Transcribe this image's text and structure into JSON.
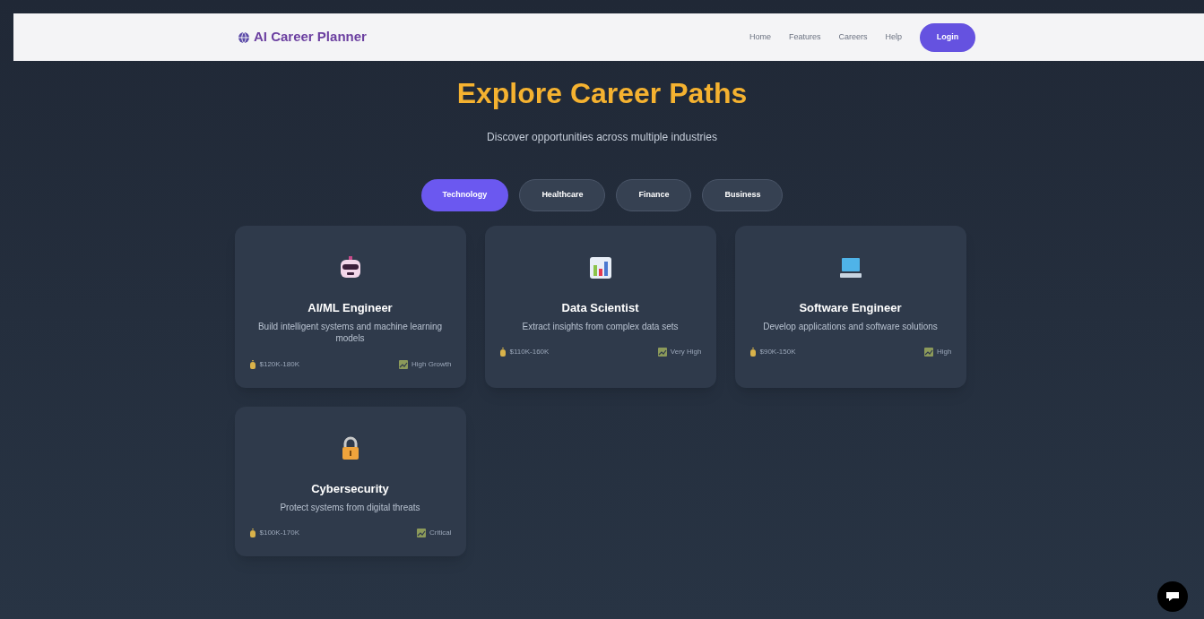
{
  "nav": {
    "brand": "AI Career Planner",
    "links": [
      "Home",
      "Features",
      "Careers",
      "Help"
    ],
    "login": "Login"
  },
  "hero": {
    "title": "Explore Career Paths",
    "subtitle": "Discover opportunities across multiple industries"
  },
  "tabs": [
    {
      "label": "Technology",
      "selected": true
    },
    {
      "label": "Healthcare",
      "selected": false
    },
    {
      "label": "Finance",
      "selected": false
    },
    {
      "label": "Business",
      "selected": false
    }
  ],
  "careers": [
    {
      "kind": "robot",
      "title": "AI/ML Engineer",
      "description": "Build intelligent systems and machine learning models",
      "salary": "$120K-180K",
      "growth": "High Growth"
    },
    {
      "kind": "chart",
      "title": "Data Scientist",
      "description": "Extract insights from complex data sets",
      "salary": "$110K-160K",
      "growth": "Very High"
    },
    {
      "kind": "laptop",
      "title": "Software Engineer",
      "description": "Develop applications and software solutions",
      "salary": "$90K-150K",
      "growth": "High"
    },
    {
      "kind": "lock",
      "title": "Cybersecurity",
      "description": "Protect systems from digital threats",
      "salary": "$100K-170K",
      "growth": "Critical"
    }
  ]
}
